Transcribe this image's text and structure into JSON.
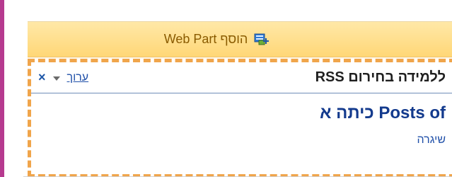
{
  "toolbar": {
    "add_webpart_label": "הוסף Web Part",
    "icon": "add-webpart-icon"
  },
  "webpart": {
    "title": "ללמידה בחירום RSS",
    "edit_label": "ערוך",
    "close_label": "×",
    "menu_icon": "dropdown-arrow-icon",
    "close_icon": "close-icon"
  },
  "feed": {
    "heading": "Posts of כיתה א",
    "item": "שיגרה"
  },
  "colors": {
    "rail": "#b63a8f",
    "header_bar": "#ffd777",
    "dashed_border": "#f0a54b",
    "link_blue": "#1f4fa8",
    "heading_blue": "#133a8d"
  }
}
